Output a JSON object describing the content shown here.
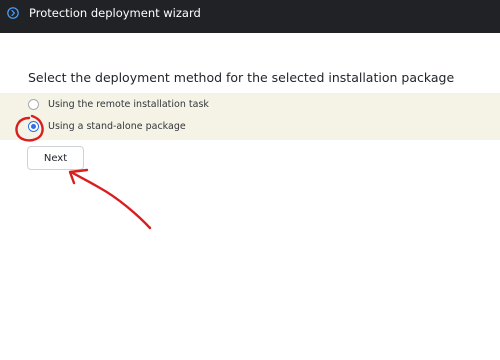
{
  "window": {
    "title": "Protection deployment wizard",
    "icon": "chevron-right-circle-icon"
  },
  "main": {
    "heading": "Select the deployment method for the selected installation package",
    "options": [
      {
        "label": "Using the remote installation task",
        "selected": false
      },
      {
        "label": "Using a stand-alone package",
        "selected": true
      }
    ],
    "next_label": "Next"
  },
  "colors": {
    "titlebar": "#202226",
    "accent": "#2f6fe4",
    "options_band": "#f4f3e6",
    "annotation": "#d81e1e"
  }
}
